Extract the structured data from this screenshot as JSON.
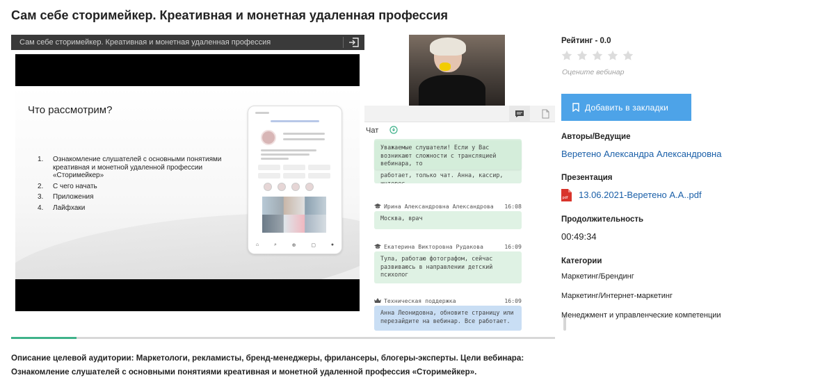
{
  "page": {
    "title": "Сам себе сторимейкер. Креативная и монетная удаленная профессия"
  },
  "player": {
    "title": "Сам себе сторимейкер. Креативная и монетная удаленная профессия",
    "exit_icon": "exit-icon",
    "slide": {
      "heading": "Что рассмотрим?",
      "items": [
        {
          "num": "1.",
          "text": "Ознакомление слушателей с основными понятиями креативная и монетной удаленной профессии «Сторимейкер»"
        },
        {
          "num": "2.",
          "text": "С чего начать"
        },
        {
          "num": "3.",
          "text": "Приложения"
        },
        {
          "num": "4.",
          "text": "Лайфхаки"
        }
      ]
    },
    "progress": 0.12
  },
  "chat": {
    "label": "Чат",
    "tab_icons": [
      "chat-icon",
      "document-icon"
    ],
    "pinned_text": "работает, только чат. Анна, кассир, интерес.",
    "notice_text": "Уважаемые слушатели! Если у Вас возникают сложности с трансляцией вебинара, то",
    "messages": [
      {
        "author": "Ирина Александровна Александрова",
        "time": "16:08",
        "text": "Москва, врач",
        "role": "student",
        "icon": "graduation-cap-icon"
      },
      {
        "author": "Екатерина Викторовна Рудакова",
        "time": "16:09",
        "text": "Тула, работаю фотографом, сейчас развиваюсь в направлении детский психолог",
        "role": "student",
        "icon": "graduation-cap-icon"
      },
      {
        "author": "Техническая поддержка",
        "time": "16:09",
        "text": "Анна Леонидовна, обновите страницу или перезайдите на вебинар. Все работает.",
        "role": "support",
        "icon": "crown-icon"
      }
    ]
  },
  "sidebar": {
    "rating_label": "Рейтинг - 0.0",
    "rating_value": 0,
    "rating_max": 5,
    "rate_hint": "Оцените вебинар",
    "bookmark_button": "Добавить в закладки",
    "authors_label": "Авторы/Ведущие",
    "author": "Веретено Александра Александровна",
    "presentation_label": "Презентация",
    "presentation_file": "13.06.2021-Веретено А.А..pdf",
    "duration_label": "Продолжительность",
    "duration": "00:49:34",
    "categories_label": "Категории",
    "categories": [
      "Маркетинг/Брендинг",
      "Маркетинг/Интернет-маркетинг",
      "Менеджмент и управленческие компетенции"
    ]
  },
  "description": {
    "line1": "Описание целевой аудитории: Маркетологи, рекламисты, бренд-менеджеры, фрилансеры, блогеры-эксперты. Цели вебинара:",
    "line2": "Ознакомление слушателей с основными понятиями креативная и монетной удаленной профессия «Сторимейкер»."
  },
  "colors": {
    "accent": "#4da3e8",
    "link": "#1a5fa8",
    "progress": "#3fb28a",
    "chat_green": "#dff2e4",
    "chat_blue": "#c9def4"
  }
}
